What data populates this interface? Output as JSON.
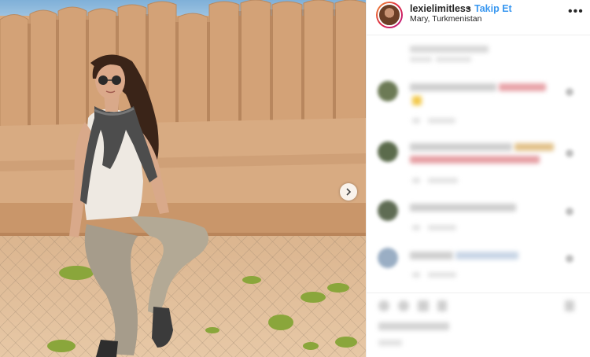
{
  "post": {
    "username": "lexielimitless",
    "separator": "•",
    "follow_label": "Takip Et",
    "location": "Mary, Turkmenistan",
    "more_icon": "more-horizontal-icon"
  },
  "colors": {
    "follow_blue": "#3897f0",
    "text_dark": "#262626",
    "border": "#efefef"
  },
  "carousel": {
    "next_icon": "chevron-right-icon"
  },
  "comments_note": ""
}
